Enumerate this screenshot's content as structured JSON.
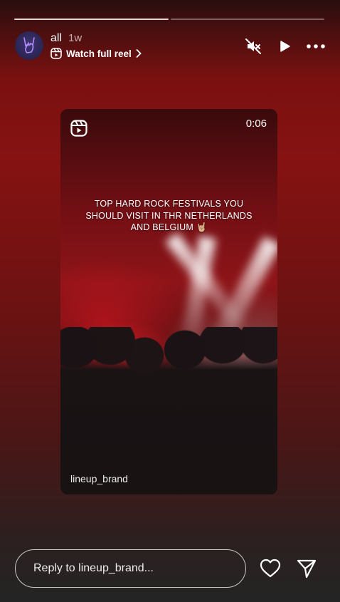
{
  "header": {
    "username": "all",
    "time_ago": "1w",
    "watch_full_reel": "Watch full reel"
  },
  "icons": {
    "avatar": "rock-hand-avatar",
    "watch": "reels-icon",
    "mute": "muted-speaker-icon",
    "play": "play-icon",
    "more": "more-dots-icon",
    "reel": "reels-icon",
    "like": "heart-icon",
    "share": "send-icon"
  },
  "reel": {
    "duration": "0:06",
    "caption": "TOP HARD ROCK FESTIVALS YOU SHOULD VISIT IN THR NETHERLANDS AND BELGIUM 🤘🏼",
    "author": "lineup_brand"
  },
  "reply": {
    "placeholder": "Reply to lineup_brand..."
  },
  "colors": {
    "accent_red": "#861212",
    "text": "#ffffff"
  }
}
